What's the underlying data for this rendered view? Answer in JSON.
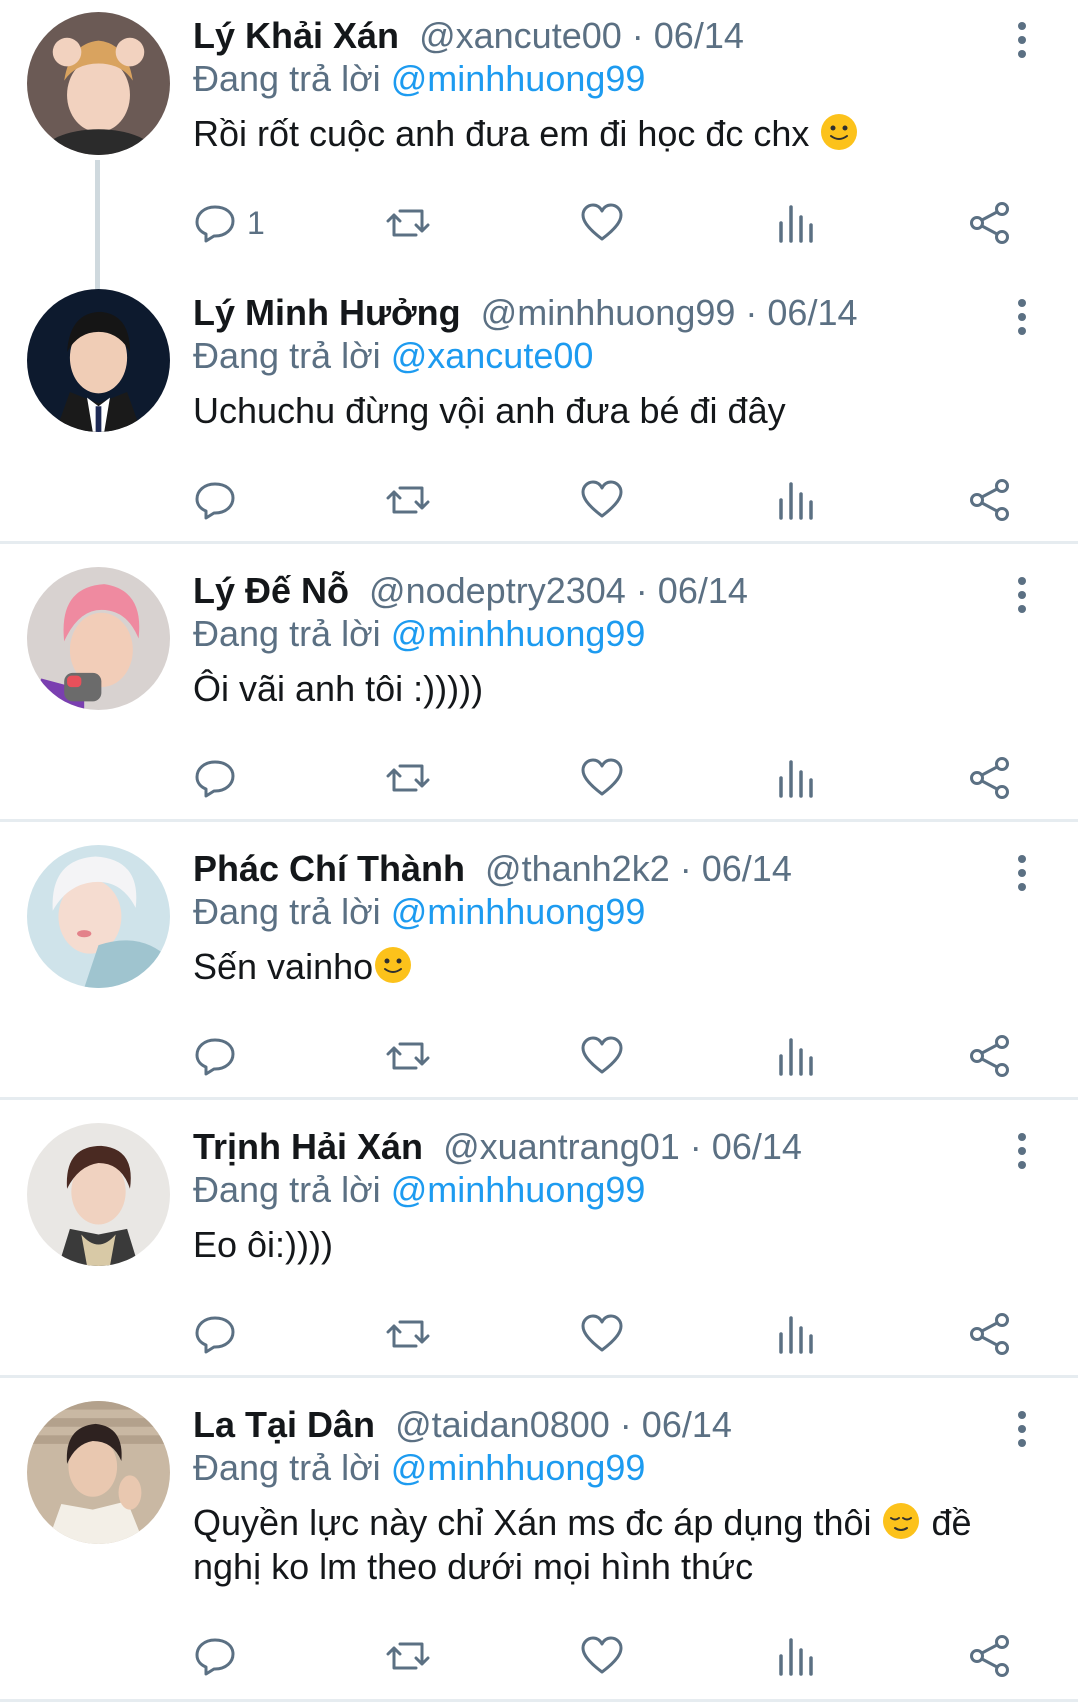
{
  "replying_label": "Đang trả lời",
  "separator": "·",
  "colors": {
    "text": "#14171a",
    "secondary": "#5b7083",
    "link": "#1d9bf0",
    "divider": "#e6ecf0"
  },
  "icons": [
    "reply-icon",
    "retweet-icon",
    "like-icon",
    "analytics-icon",
    "share-icon",
    "more-icon",
    "slightly-smiling-face-emoji",
    "relieved-face-emoji"
  ],
  "tweets": [
    {
      "name": "Lý Khải Xán",
      "handle": "@xancute00",
      "date": "06/14",
      "replying_to": "@minhhuong99",
      "text": "Rồi rốt cuộc anh đưa em đi học đc chx ",
      "text2": "",
      "reply_count": "1"
    },
    {
      "name": "Lý Minh Hưởng",
      "handle": "@minhhuong99",
      "date": "06/14",
      "replying_to": "@xancute00",
      "text": "Uchuchu đừng vội anh đưa bé đi đây",
      "text2": "",
      "reply_count": ""
    },
    {
      "name": "Lý Đế Nỗ",
      "handle": "@nodeptry2304",
      "date": "06/14",
      "replying_to": "@minhhuong99",
      "text": "Ôi vãi anh tôi :)))))",
      "text2": "",
      "reply_count": ""
    },
    {
      "name": "Phác Chí Thành",
      "handle": "@thanh2k2",
      "date": "06/14",
      "replying_to": "@minhhuong99",
      "text": "Sến vainho",
      "text2": "",
      "reply_count": ""
    },
    {
      "name": "Trịnh Hải Xán",
      "handle": "@xuantrang01",
      "date": "06/14",
      "replying_to": "@minhhuong99",
      "text": "Eo ôi:))))",
      "text2": "",
      "reply_count": ""
    },
    {
      "name": "La Tại Dân",
      "handle": "@taidan0800",
      "date": "06/14",
      "replying_to": "@minhhuong99",
      "text": "Quyền lực này chỉ Xán ms đc áp dụng thôi ",
      "text2": " đề nghị ko lm theo dưới mọi hình thức",
      "reply_count": ""
    }
  ]
}
